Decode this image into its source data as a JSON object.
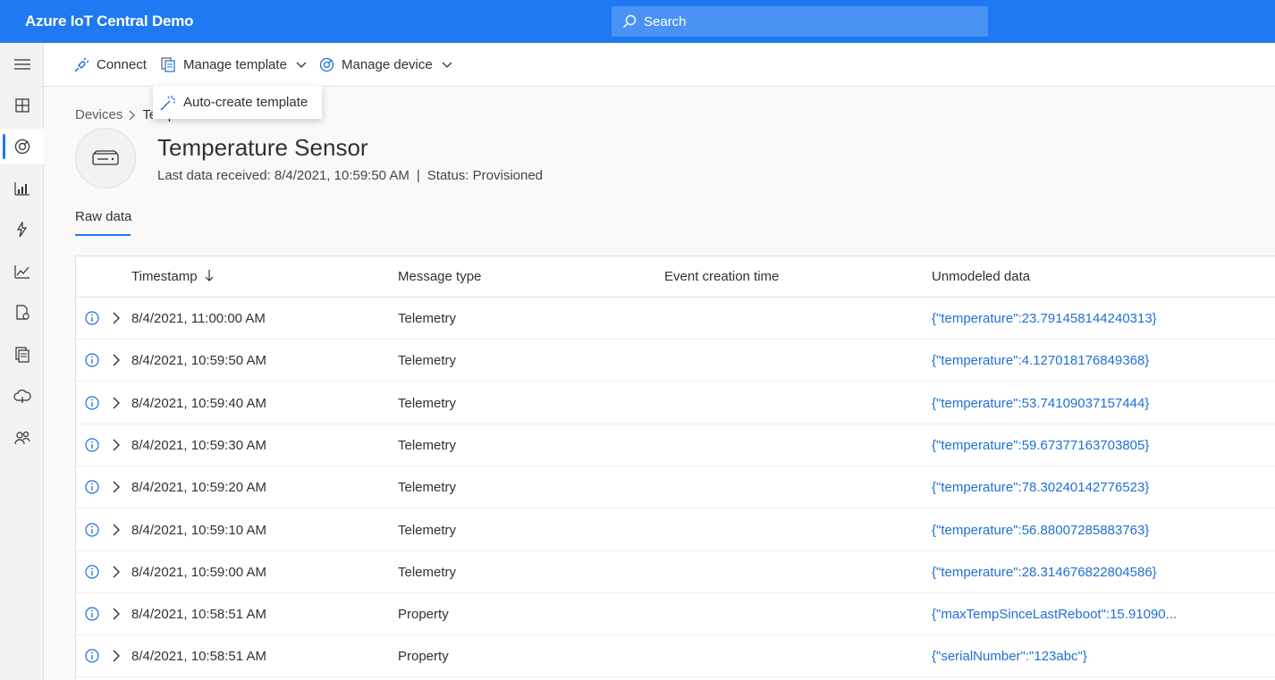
{
  "app": {
    "title": "Azure IoT Central Demo",
    "search_placeholder": "Search"
  },
  "rail": {
    "items": [
      {
        "icon": "hamburger-menu-icon"
      },
      {
        "icon": "dashboard-icon"
      },
      {
        "icon": "devices-icon",
        "active": true
      },
      {
        "icon": "device-groups-icon"
      },
      {
        "icon": "rules-icon"
      },
      {
        "icon": "analytics-icon"
      },
      {
        "icon": "jobs-icon"
      },
      {
        "icon": "device-templates-icon"
      },
      {
        "icon": "data-export-icon"
      },
      {
        "icon": "permissions-icon"
      }
    ]
  },
  "commands": {
    "connect": "Connect",
    "manage_template": "Manage template",
    "manage_device": "Manage device",
    "dropdown_item": "Auto-create template"
  },
  "breadcrumb": {
    "root": "Devices",
    "current": "Temperature Sensor"
  },
  "device": {
    "name": "Temperature Sensor",
    "last_data": "Last data received: 8/4/2021, 10:59:50 AM",
    "status": "Status: Provisioned"
  },
  "tabs": {
    "raw_data": "Raw data"
  },
  "table": {
    "headers": {
      "timestamp": "Timestamp",
      "message_type": "Message type",
      "event_creation_time": "Event creation time",
      "unmodeled_data": "Unmodeled data"
    },
    "rows": [
      {
        "timestamp": "8/4/2021, 11:00:00 AM",
        "type": "Telemetry",
        "event_time": "",
        "data": "{\"temperature\":23.791458144240313}"
      },
      {
        "timestamp": "8/4/2021, 10:59:50 AM",
        "type": "Telemetry",
        "event_time": "",
        "data": "{\"temperature\":4.127018176849368}"
      },
      {
        "timestamp": "8/4/2021, 10:59:40 AM",
        "type": "Telemetry",
        "event_time": "",
        "data": "{\"temperature\":53.74109037157444}"
      },
      {
        "timestamp": "8/4/2021, 10:59:30 AM",
        "type": "Telemetry",
        "event_time": "",
        "data": "{\"temperature\":59.67377163703805}"
      },
      {
        "timestamp": "8/4/2021, 10:59:20 AM",
        "type": "Telemetry",
        "event_time": "",
        "data": "{\"temperature\":78.30240142776523}"
      },
      {
        "timestamp": "8/4/2021, 10:59:10 AM",
        "type": "Telemetry",
        "event_time": "",
        "data": "{\"temperature\":56.88007285883763}"
      },
      {
        "timestamp": "8/4/2021, 10:59:00 AM",
        "type": "Telemetry",
        "event_time": "",
        "data": "{\"temperature\":28.314676822804586}"
      },
      {
        "timestamp": "8/4/2021, 10:58:51 AM",
        "type": "Property",
        "event_time": "",
        "data": "{\"maxTempSinceLastReboot\":15.91090..."
      },
      {
        "timestamp": "8/4/2021, 10:58:51 AM",
        "type": "Property",
        "event_time": "",
        "data": "{\"serialNumber\":\"123abc\"}"
      }
    ]
  }
}
